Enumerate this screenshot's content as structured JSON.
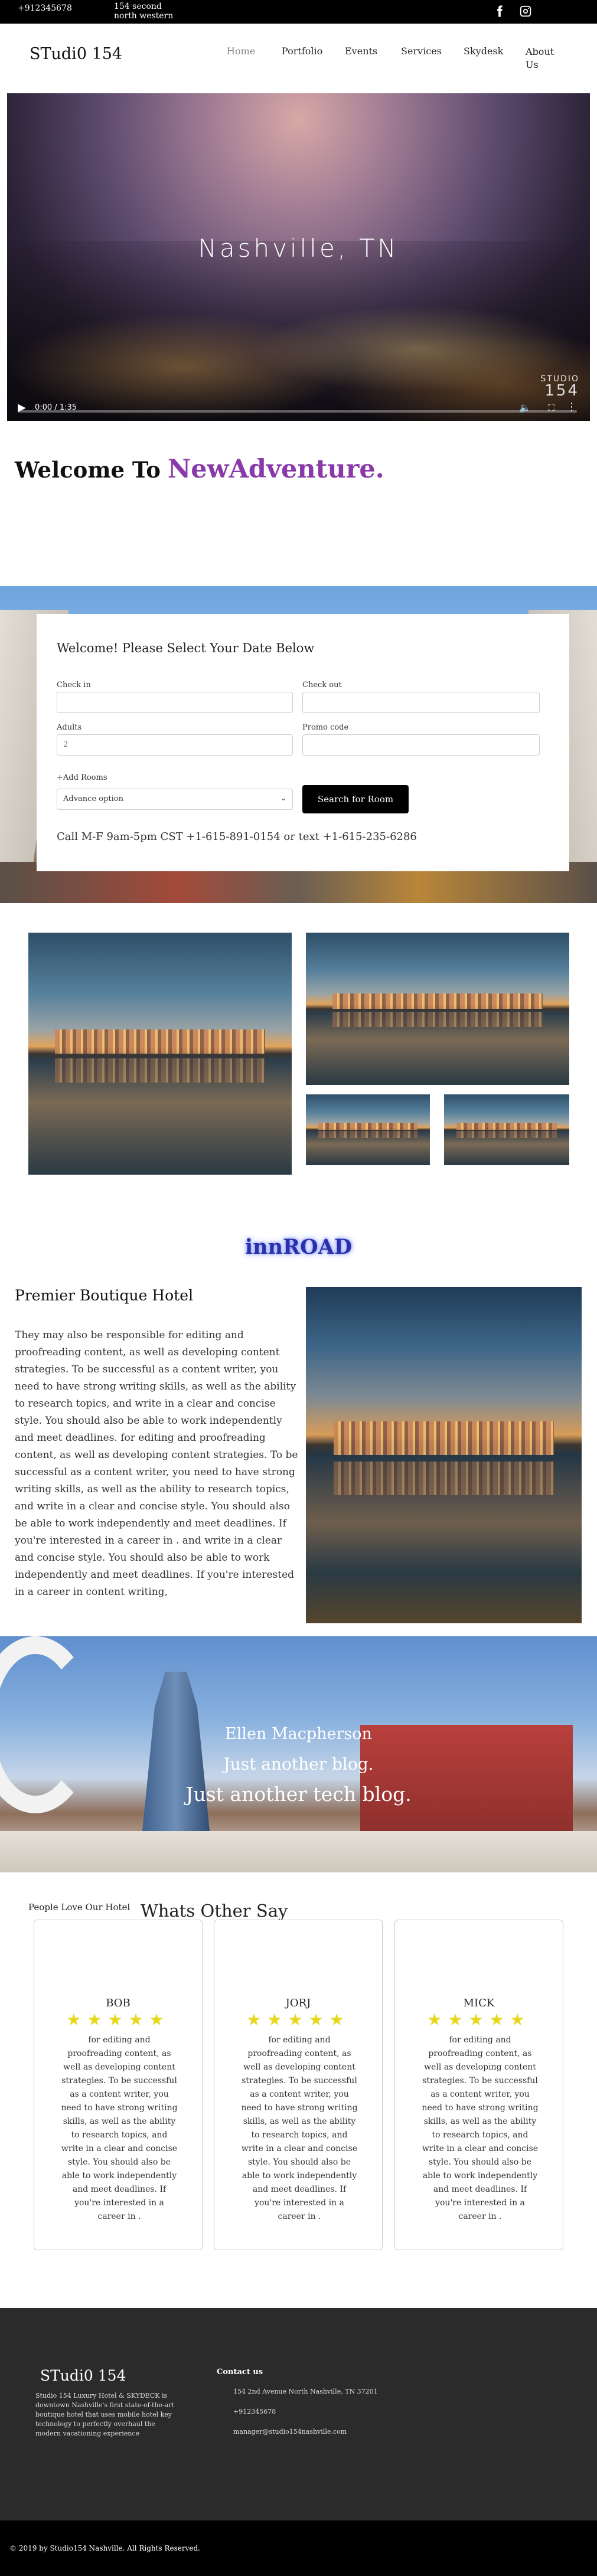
{
  "topbar": {
    "phone": "+912345678",
    "address": "154 second north western",
    "social": [
      "facebook-icon",
      "instagram-icon"
    ]
  },
  "header": {
    "logo": "STudi0 154",
    "nav": [
      "Home",
      "Portfolio",
      "Events",
      "Services",
      "Skydesk",
      "About Us"
    ],
    "active_nav": "Home"
  },
  "video": {
    "caption": "Nashville, TN",
    "brand_line1": "STUDIO",
    "brand_line2": "154",
    "time": "0:00 / 1:35",
    "progress": 0
  },
  "welcome": {
    "lead": "Welcome To",
    "accent": "NewAdventure."
  },
  "booking": {
    "title": "Welcome! Please Select Your Date Below",
    "checkin_label": "Check in",
    "checkout_label": "Check out",
    "adults_label": "Adults",
    "adults_value": "2",
    "promo_label": "Promo code",
    "add_rooms": "+Add Rooms",
    "advance_option": "Advance option",
    "search_button": "Search for Room",
    "call_text": "Call M-F 9am-5pm CST +1-615-891-0154 or text +1-615-235-6286"
  },
  "innroad": "innROAD",
  "premier": {
    "title": "Premier Boutique Hotel",
    "text": "They may also be responsible for editing and proofreading content, as well as developing content strategies. To be successful as a content writer, you need to have strong writing skills, as well as the ability to research topics, and write in a clear and concise style. You should also be able to work independently and meet deadlines. for editing and proofreading content, as well as developing content strategies. To be successful as a content writer, you need to have strong writing skills, as well as the ability to research topics, and write in a clear and concise style. You should also be able to work independently and meet deadlines. If you're interested in a career in . and write in a clear and concise style. You should also be able to work independently and meet deadlines. If you're interested in a career in content writing,"
  },
  "banner": {
    "line1": "Ellen Macpherson",
    "line2": "Just another blog.",
    "line3": "Just another tech blog."
  },
  "testimonials": {
    "kicker": "People Love Our Hotel",
    "heading": "Whats Other Say",
    "stars": "★★★★★",
    "items": [
      {
        "name": "BOB",
        "rating": 5,
        "text": "for editing and proofreading content, as well as developing content strategies. To be successful as a content writer, you need to have strong writing skills, as well as the ability to research topics, and write in a clear and concise style. You should also be able to work independently and meet deadlines. If you're interested in a career in ."
      },
      {
        "name": "JORJ",
        "rating": 5,
        "text": "for editing and proofreading content, as well as developing content strategies. To be successful as a content writer, you need to have strong writing skills, as well as the ability to research topics, and write in a clear and concise style. You should also be able to work independently and meet deadlines. If you're interested in a career in ."
      },
      {
        "name": "MICK",
        "rating": 5,
        "text": "for editing and proofreading content, as well as developing content strategies. To be successful as a content writer, you need to have strong writing skills, as well as the ability to research topics, and write in a clear and concise style. You should also be able to work independently and meet deadlines. If you're interested in a career in ."
      }
    ]
  },
  "footer": {
    "logo": "STudi0 154",
    "description": "Studio 154 Luxury Hotel & SKYDECK is downtown Nashville's first state-of-the-art boutique hotel that uses mobile hotel key technology to perfectly overhaul the modern vacationing experience",
    "contact_heading": "Contact us",
    "address": "154 2nd Avenue North Nashville, TN 37201",
    "phone": "+912345678",
    "email": "manager@studio154nashville.com",
    "copyright": "© 2019 by Studio154 Nashville. All Rights Reserved."
  }
}
